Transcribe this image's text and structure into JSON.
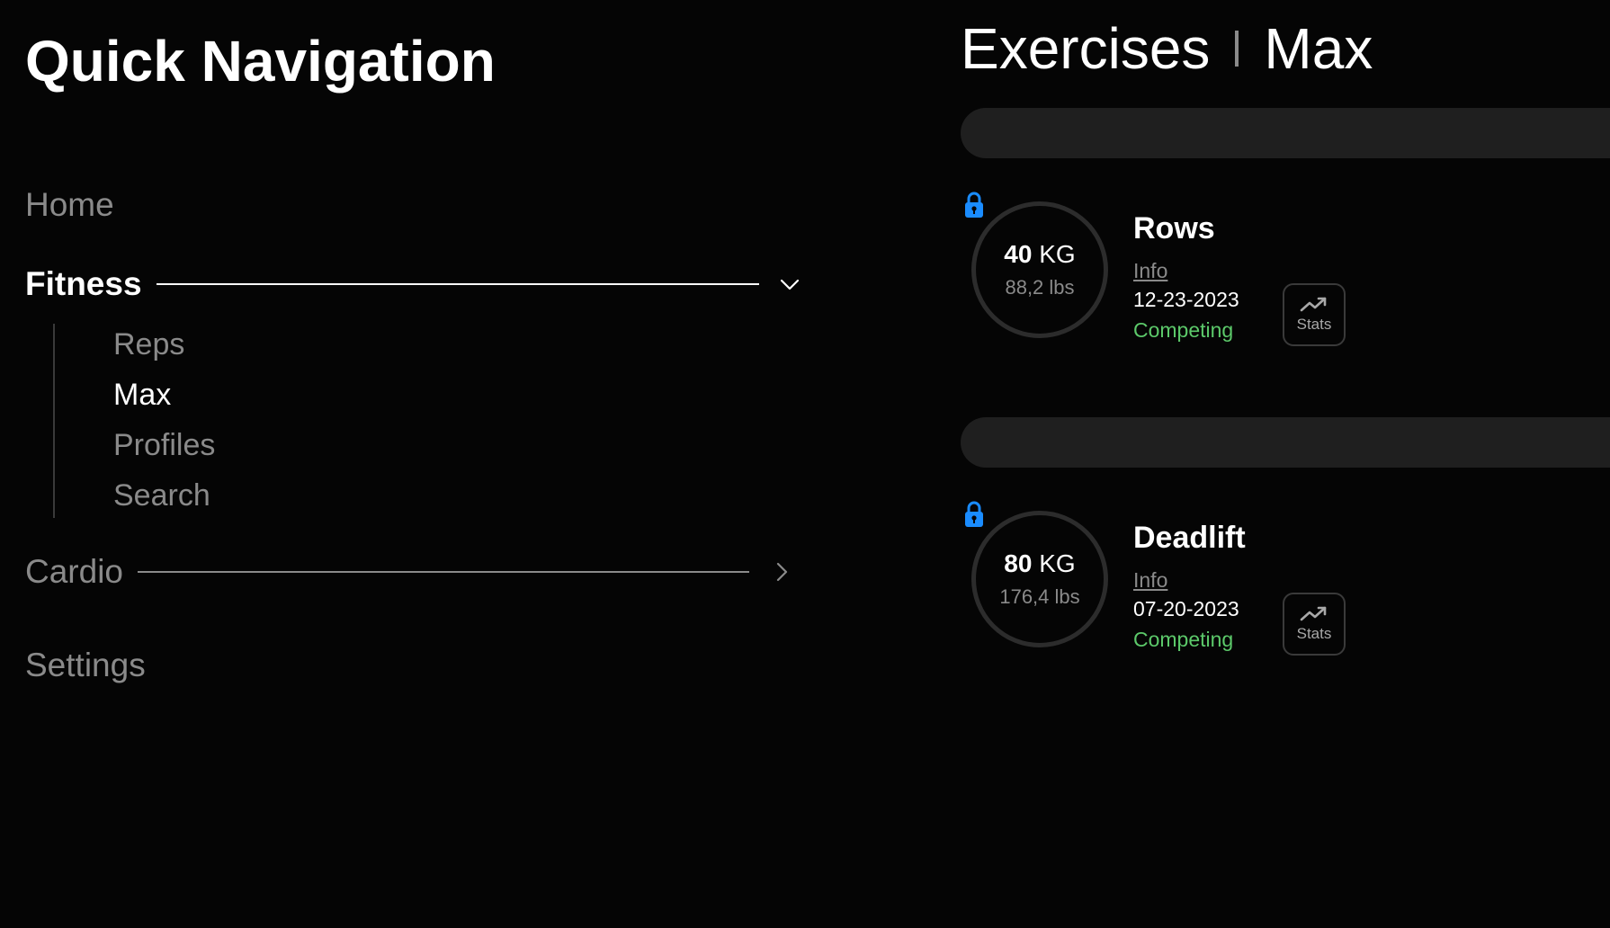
{
  "nav": {
    "title": "Quick Navigation",
    "items": [
      {
        "label": "Home"
      },
      {
        "label": "Fitness",
        "expanded": true,
        "icon": "chevron-down-icon"
      },
      {
        "label": "Cardio",
        "expanded": false,
        "icon": "chevron-right-icon"
      },
      {
        "label": "Settings"
      }
    ],
    "fitness_sub": [
      {
        "label": "Reps"
      },
      {
        "label": "Max",
        "active": true
      },
      {
        "label": "Profiles"
      },
      {
        "label": "Search"
      }
    ]
  },
  "breadcrumb": {
    "section": "Exercises",
    "page": "Max"
  },
  "exercises": [
    {
      "name": "Rows",
      "kg_value": "40",
      "kg_unit": "KG",
      "lbs": "88,2 lbs",
      "info_label": "Info",
      "date": "12-23-2023",
      "status": "Competing",
      "stats_label": "Stats",
      "locked": true
    },
    {
      "name": "Deadlift",
      "kg_value": "80",
      "kg_unit": "KG",
      "lbs": "176,4 lbs",
      "info_label": "Info",
      "date": "07-20-2023",
      "status": "Competing",
      "stats_label": "Stats",
      "locked": true
    }
  ],
  "colors": {
    "background": "#050505",
    "text_primary": "#ffffff",
    "text_muted": "#8a8a8a",
    "status_green": "#5cc96a",
    "lock_blue": "#1a8cff",
    "bar": "#1f1f1f"
  }
}
